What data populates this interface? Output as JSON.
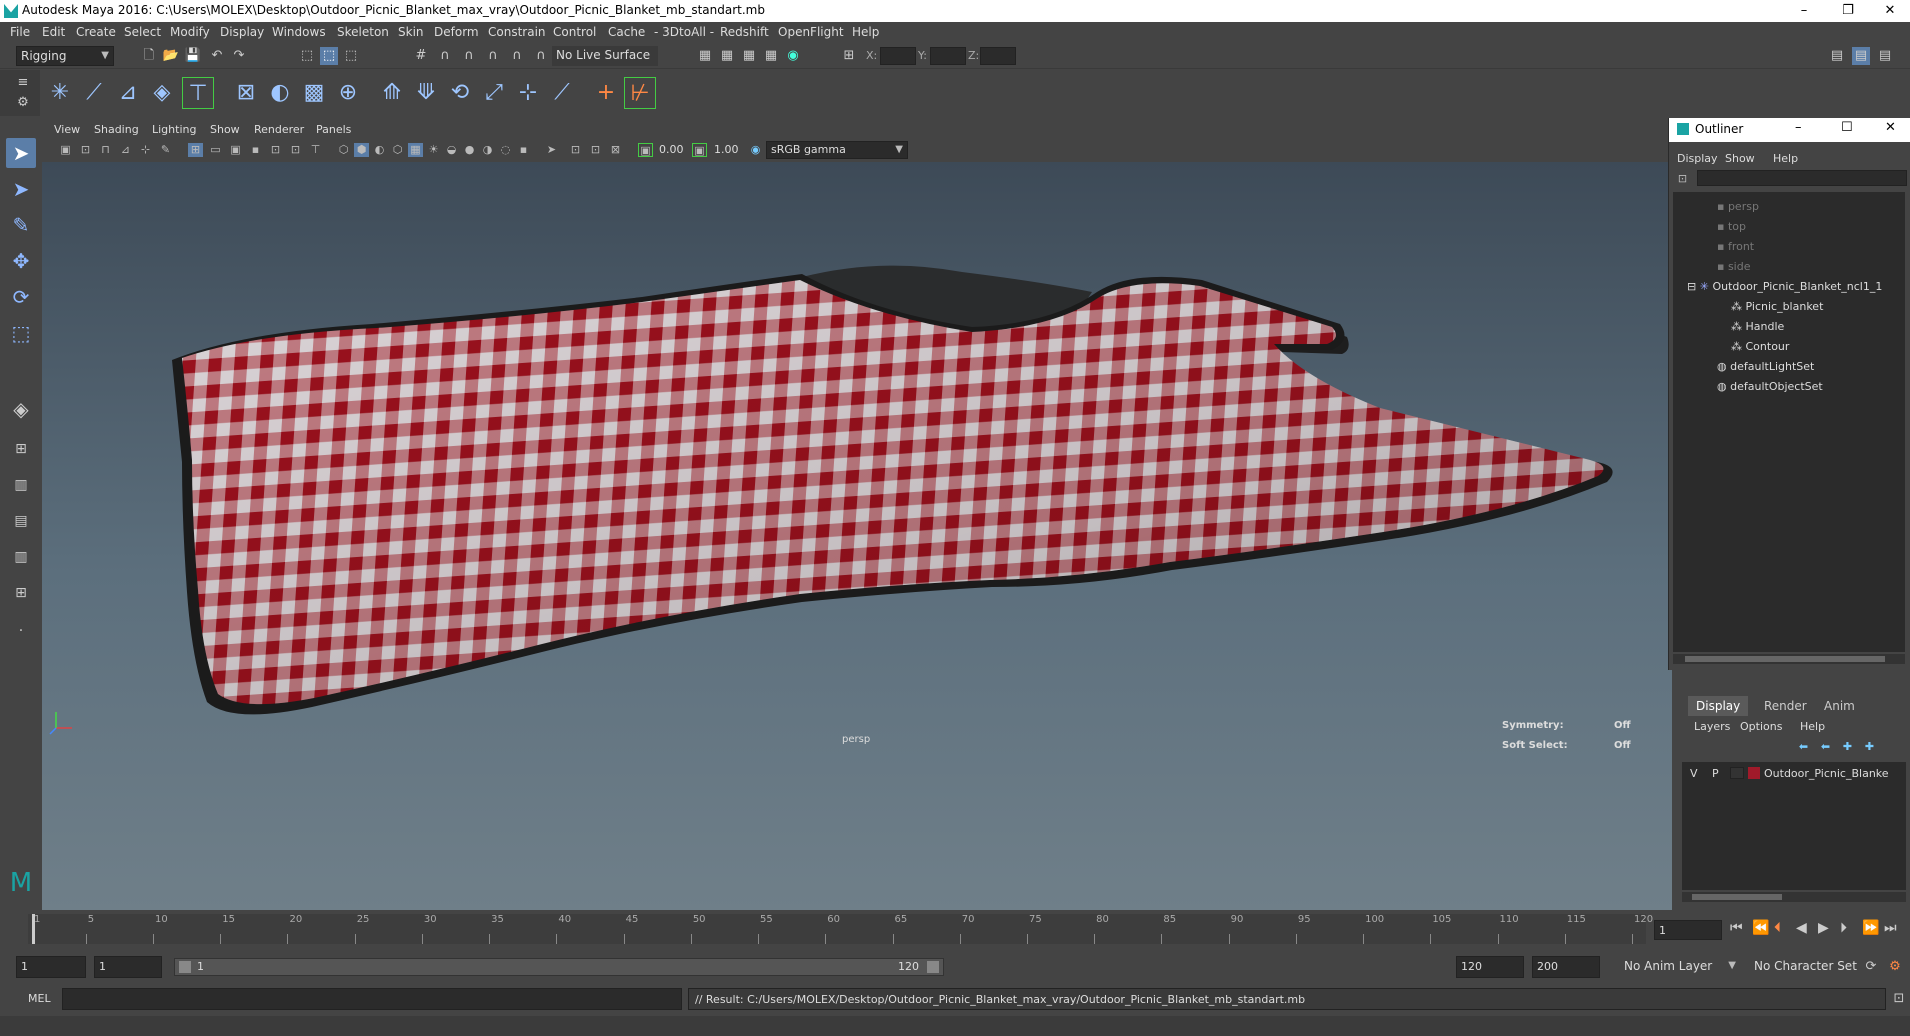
{
  "window": {
    "title": "Autodesk Maya 2016: C:\\Users\\MOLEX\\Desktop\\Outdoor_Picnic_Blanket_max_vray\\Outdoor_Picnic_Blanket_mb_standart.mb",
    "minimize": "–",
    "restore": "❐",
    "close": "✕"
  },
  "menubar": [
    "File",
    "Edit",
    "Create",
    "Select",
    "Modify",
    "Display",
    "Windows",
    "Skeleton",
    "Skin",
    "Deform",
    "Constrain",
    "Control",
    "Cache",
    "- 3DtoAll -",
    "Redshift",
    "OpenFlight",
    "Help"
  ],
  "statusline": {
    "mode": "Rigging",
    "live_surface": "No Live Surface",
    "x_label": "X:",
    "y_label": "Y:",
    "z_label": "Z:"
  },
  "viewport_menu": [
    "View",
    "Shading",
    "Lighting",
    "Show",
    "Renderer",
    "Panels"
  ],
  "viewport_toolbar": {
    "exposure": "0.00",
    "gamma": "1.00",
    "colorspace": "sRGB gamma"
  },
  "viewport": {
    "camera": "persp",
    "symmetry_label": "Symmetry:",
    "symmetry_value": "Off",
    "softselect_label": "Soft Select:",
    "softselect_value": "Off"
  },
  "outliner": {
    "title": "Outliner",
    "menu": [
      "Display",
      "Show",
      "Help"
    ],
    "cameras": [
      "persp",
      "top",
      "front",
      "side"
    ],
    "root": "Outdoor_Picnic_Blanket_ncl1_1",
    "children": [
      "Picnic_blanket",
      "Handle",
      "Contour"
    ],
    "sets": [
      "defaultLightSet",
      "defaultObjectSet"
    ]
  },
  "layers": {
    "tabs": [
      "Display",
      "Render",
      "Anim"
    ],
    "menu": [
      "Layers",
      "Options",
      "Help"
    ],
    "layer_v": "V",
    "layer_p": "P",
    "layer_name": "Outdoor_Picnic_Blanke",
    "layer_color": "#a01a2a"
  },
  "timeslider": {
    "ticks": [
      "1",
      "5",
      "10",
      "15",
      "20",
      "25",
      "30",
      "35",
      "40",
      "45",
      "50",
      "55",
      "60",
      "65",
      "70",
      "75",
      "80",
      "85",
      "90",
      "95",
      "100",
      "105",
      "110",
      "115",
      "120"
    ],
    "current_frame": "1"
  },
  "rangeslider": {
    "start": "1",
    "playback_start": "1",
    "range_inner_start": "1",
    "range_inner_end": "120",
    "playback_end": "120",
    "end": "200",
    "anim_layer": "No Anim Layer",
    "character_set": "No Character Set"
  },
  "cmdline": {
    "lang": "MEL",
    "result": "// Result: C:/Users/MOLEX/Desktop/Outdoor_Picnic_Blanket_max_vray/Outdoor_Picnic_Blanket_mb_standart.mb"
  },
  "colors": {
    "blanket_red": "#a3121f",
    "blanket_white": "#e6dfe2",
    "accent_blue": "#5b7ea8"
  }
}
